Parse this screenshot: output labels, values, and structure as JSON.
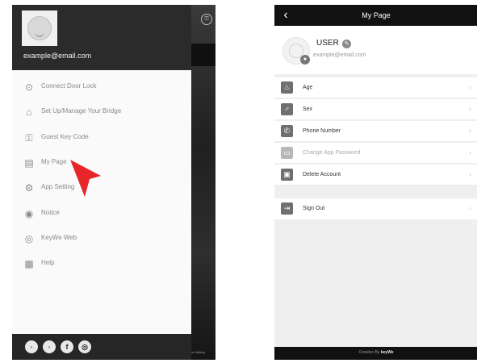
{
  "left_screen": {
    "email": "example@email.com",
    "menu": [
      {
        "icon": "lock-icon",
        "glyph": "⊙",
        "label": "Connect Door Lock"
      },
      {
        "icon": "bridge-icon",
        "glyph": "⌂",
        "label": "Set Up/Manage Your Bridge"
      },
      {
        "icon": "guest-key-icon",
        "glyph": "⚿",
        "label": "Guest Key Code"
      },
      {
        "icon": "my-page-icon",
        "glyph": "▤",
        "label": "My Page"
      },
      {
        "icon": "gear-icon",
        "glyph": "⚙",
        "label": "App Setting"
      },
      {
        "icon": "notice-icon",
        "glyph": "◉",
        "label": "Notice"
      },
      {
        "icon": "web-icon",
        "glyph": "◎",
        "label": "KeyWe Web"
      },
      {
        "icon": "help-icon",
        "glyph": "▦",
        "label": "Help"
      }
    ],
    "social": [
      {
        "icon": "chat-icon",
        "glyph": "◦"
      },
      {
        "icon": "message-icon",
        "glyph": "◦"
      },
      {
        "icon": "facebook-icon",
        "glyph": "f"
      },
      {
        "icon": "instagram-icon",
        "glyph": "◎"
      }
    ],
    "background_label": "ia Setting"
  },
  "right_screen": {
    "title": "My Page",
    "back_glyph": "‹",
    "user_name": "USER",
    "edit_glyph": "✎",
    "camera_glyph": "●",
    "email": "example@email.com",
    "rows": [
      {
        "icon": "age-icon",
        "glyph": "♨",
        "label": "Age",
        "dim": false
      },
      {
        "icon": "sex-icon",
        "glyph": "♂",
        "label": "Sex",
        "dim": false
      },
      {
        "icon": "phone-icon",
        "glyph": "✆",
        "label": "Phone Number",
        "dim": false
      },
      {
        "icon": "password-icon",
        "glyph": "▭",
        "label": "Change App Password",
        "dim": true
      },
      {
        "icon": "delete-account-icon",
        "glyph": "▣",
        "label": "Delete Account",
        "dim": false
      }
    ],
    "signout": {
      "icon": "sign-out-icon",
      "glyph": "⇥",
      "label": "Sign Out"
    },
    "chevron": "›",
    "footer_prefix": "Creative By",
    "footer_brand": "keyWe"
  }
}
